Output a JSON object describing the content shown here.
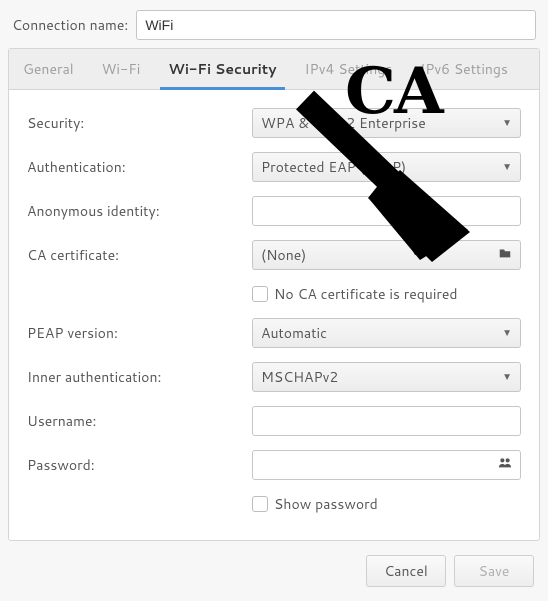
{
  "header": {
    "connection_name_label": "Connection name:",
    "connection_name_value": "WiFi"
  },
  "tabs": {
    "general": "General",
    "wifi": "Wi-Fi",
    "wifi_security": "Wi-Fi Security",
    "ipv4": "IPv4 Settings",
    "ipv6": "IPv6 Settings"
  },
  "form": {
    "security_label": "Security:",
    "security_value": "WPA & WPA2 Enterprise",
    "authentication_label": "Authentication:",
    "authentication_value": "Protected EAP (PEAP)",
    "anon_identity_label": "Anonymous identity:",
    "anon_identity_value": "",
    "ca_cert_label": "CA certificate:",
    "ca_cert_value": "(None)",
    "no_ca_label": "No CA certificate is required",
    "peap_version_label": "PEAP version:",
    "peap_version_value": "Automatic",
    "inner_auth_label": "Inner authentication:",
    "inner_auth_value": "MSCHAPv2",
    "username_label": "Username:",
    "username_value": "",
    "password_label": "Password:",
    "password_value": "",
    "show_password_label": "Show password"
  },
  "buttons": {
    "cancel": "Cancel",
    "save": "Save"
  },
  "annotation": {
    "text": "CA"
  }
}
